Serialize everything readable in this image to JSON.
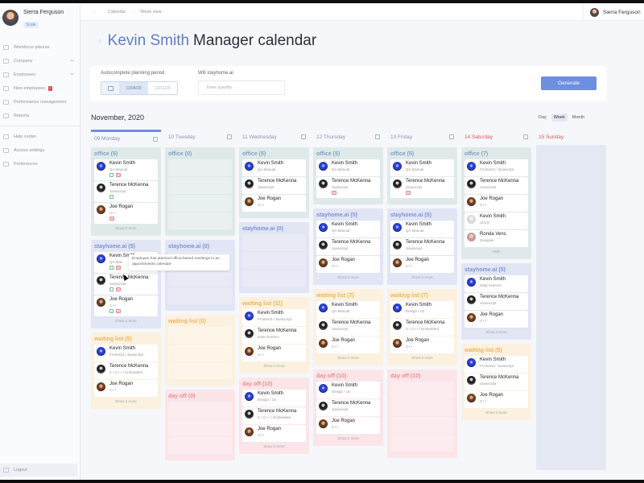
{
  "sidebar": {
    "user_name": "Sierra Ferguson",
    "user_badge": "Scale",
    "items": [
      {
        "label": "Workforce planner",
        "icon": "calendar-icon"
      },
      {
        "label": "Company",
        "icon": "building-icon"
      },
      {
        "label": "Employees",
        "icon": "users-icon"
      },
      {
        "label": "New employees",
        "icon": "user-plus-icon",
        "badge": "!"
      },
      {
        "label": "Performance management",
        "icon": "chart-icon"
      },
      {
        "label": "Reports",
        "icon": "report-icon"
      }
    ],
    "items2": [
      {
        "label": "Help center",
        "icon": "help-icon"
      },
      {
        "label": "Access settings",
        "icon": "lock-icon"
      },
      {
        "label": "Preferences",
        "icon": "gear-icon"
      }
    ],
    "logout": "Logout"
  },
  "topbar": {
    "breadcrumb": [
      "Calendar",
      "Week view"
    ],
    "user_name": "Sierra Ferguson"
  },
  "header": {
    "name": "Kevin Smith",
    "subtitle": "Manager calendar"
  },
  "planning": {
    "period_label": "Autocomplete planning period",
    "date_from": "11/04/20",
    "date_to": "12/11/20",
    "quantity_label": "Will stayhome.ai",
    "quantity_placeholder": "Enter quantity",
    "generate": "Generate"
  },
  "month": "November, 2020",
  "views": [
    "Day",
    "Week",
    "Month"
  ],
  "active_view": "Week",
  "tooltip": "Employee has planned office-based meetings in an appointments calendar",
  "show_more": "Show 2 more",
  "days": [
    {
      "label": "09 Monday",
      "weekend": false,
      "active": true,
      "sections": [
        {
          "type": "office",
          "title": "office (5)",
          "people": [
            {
              "name": "Kevin Smith",
              "role": "QA Manual",
              "av": "kevin",
              "icons": [
                "g",
                "r"
              ]
            },
            {
              "name": "Terence McKenna",
              "role": "Javascript",
              "av": "ter",
              "icons": [
                "g"
              ]
            },
            {
              "name": "Joe Rogan",
              "role": "C++",
              "av": "joe",
              "icons": [
                "r"
              ]
            }
          ],
          "more": true
        },
        {
          "type": "stay",
          "title": "stayhome.ai (5)",
          "people": [
            {
              "name": "Kevin Smith",
              "role": "QA Man",
              "av": "kevin",
              "icons": [
                "g",
                "r"
              ]
            },
            {
              "name": "Terence McKenna",
              "role": "Javascript",
              "av": "ter",
              "icons": [
                "g",
                "r"
              ]
            },
            {
              "name": "Joe Rogan",
              "role": "C++",
              "av": "joe",
              "icons": [
                "g",
                "r"
              ]
            }
          ],
          "more": true
        },
        {
          "type": "wait",
          "title": "waiting list (5)",
          "people": [
            {
              "name": "Kevin Smith",
              "role": "Frontend / Javascript",
              "av": "kevin"
            },
            {
              "name": "Terence McKenna",
              "role": "C / C++ / Embedded",
              "av": "ter"
            },
            {
              "name": "Joe Rogan",
              "role": "C++",
              "av": "joe"
            }
          ],
          "more": true
        }
      ]
    },
    {
      "label": "10 Tuesday",
      "weekend": false,
      "sections": [
        {
          "type": "office",
          "title": "office (0)",
          "slots": 4
        },
        {
          "type": "stay",
          "title": "stayhome.ai (0)",
          "slots": 3
        },
        {
          "type": "wait",
          "title": "waiting list (0)",
          "slots": 3
        },
        {
          "type": "off",
          "title": "day off (0)",
          "slots": 3
        }
      ]
    },
    {
      "label": "11 Wednesday",
      "weekend": false,
      "sections": [
        {
          "type": "office",
          "title": "office (5)",
          "people": [
            {
              "name": "Kevin Smith",
              "role": "QA Manual",
              "av": "kevin"
            },
            {
              "name": "Terence McKenna",
              "role": "Javascript",
              "av": "ter"
            },
            {
              "name": "Joe Rogan",
              "role": "C++",
              "av": "joe"
            }
          ]
        },
        {
          "type": "stay",
          "title": "stayhome.ai (0)",
          "slots": 3
        },
        {
          "type": "wait",
          "title": "waiting list (11)",
          "people": [
            {
              "name": "Kevin Smith",
              "role": "Frontend / Javascript",
              "av": "kevin"
            },
            {
              "name": "Terence McKenna",
              "role": "Data Science",
              "av": "ter"
            },
            {
              "name": "Joe Rogan",
              "role": "C++",
              "av": "joe"
            }
          ],
          "more": true
        },
        {
          "type": "off",
          "title": "day off (10)",
          "people": [
            {
              "name": "Kevin Smith",
              "role": "Design / Ux",
              "av": "kevin"
            },
            {
              "name": "Terence McKenna",
              "role": "C / C++ / Embedded",
              "av": "ter"
            },
            {
              "name": "Joe Rogan",
              "role": "C++",
              "av": "joe"
            }
          ],
          "more": true
        }
      ]
    },
    {
      "label": "12 Thursday",
      "weekend": false,
      "sections": [
        {
          "type": "office",
          "title": "office (5)",
          "people": [
            {
              "name": "Kevin Smith",
              "role": "QA Manual",
              "av": "kevin"
            },
            {
              "name": "Terence McKenna",
              "role": "Javascript",
              "av": "ter",
              "icons": [
                "r"
              ]
            }
          ]
        },
        {
          "type": "stay",
          "title": "stayhome.ai (5)",
          "people": [
            {
              "name": "Kevin Smith",
              "role": "QA Manual",
              "av": "kevin"
            },
            {
              "name": "Terence McKenna",
              "role": "Javascript",
              "av": "ter"
            },
            {
              "name": "Joe Rogan",
              "role": "C++",
              "av": "joe"
            }
          ],
          "more": true
        },
        {
          "type": "wait",
          "title": "waiting list (7)",
          "people": [
            {
              "name": "Kevin Smith",
              "role": "QA Manual",
              "av": "kevin"
            },
            {
              "name": "Terence McKenna",
              "role": "Javascript",
              "av": "ter"
            },
            {
              "name": "Joe Rogan",
              "role": "C++",
              "av": "joe"
            }
          ],
          "more": true
        },
        {
          "type": "off",
          "title": "day off (10)",
          "people": [
            {
              "name": "Kevin Smith",
              "role": "Design / Ux",
              "av": "kevin"
            },
            {
              "name": "Terence McKenna",
              "role": "Javascript",
              "av": "ter"
            },
            {
              "name": "Joe Rogan",
              "role": "C++",
              "av": "joe"
            }
          ],
          "more": true
        }
      ]
    },
    {
      "label": "13 Friday",
      "weekend": false,
      "sections": [
        {
          "type": "office",
          "title": "office (5)",
          "people": [
            {
              "name": "Kevin Smith",
              "role": "QA Manual",
              "av": "kevin"
            },
            {
              "name": "Terence McKenna",
              "role": "Javascript",
              "av": "ter",
              "icons": [
                "r"
              ]
            }
          ]
        },
        {
          "type": "stay",
          "title": "stayhome.ai (5)",
          "people": [
            {
              "name": "Kevin Smith",
              "role": "QA Manual",
              "av": "kevin"
            },
            {
              "name": "Terence McKenna",
              "role": "Javascript",
              "av": "ter"
            },
            {
              "name": "Joe Rogan",
              "role": "C++",
              "av": "joe"
            }
          ],
          "more": true
        },
        {
          "type": "wait",
          "title": "waiting list (7)",
          "people": [
            {
              "name": "Kevin Smith",
              "role": "Design / Ux",
              "av": "kevin"
            },
            {
              "name": "Terence McKenna",
              "role": "C / C++ / Embedded",
              "av": "ter"
            },
            {
              "name": "Joe Rogan",
              "role": "C++",
              "av": "joe"
            }
          ],
          "more": true
        },
        {
          "type": "off",
          "title": "day off (10)",
          "slots": 4
        }
      ]
    },
    {
      "label": "14 Saturday",
      "weekend": true,
      "sections": [
        {
          "type": "office",
          "title": "office (7)",
          "people": [
            {
              "name": "Kevin Smith",
              "role": "Frontend / Javascript",
              "av": "kevin"
            },
            {
              "name": "Terence McKenna",
              "role": "Javascript",
              "av": "ter"
            },
            {
              "name": "Joe Rogan",
              "role": "C++",
              "av": "joe"
            },
            {
              "name": "Kevin Smith",
              "role": "UI/UX",
              "av": "smith"
            },
            {
              "name": "Ronda Vens",
              "role": "Designer",
              "av": "ronda"
            }
          ],
          "more": true,
          "more_label": "Hide"
        },
        {
          "type": "stay",
          "title": "stayhome.ai (5)",
          "people": [
            {
              "name": "Kevin Smith",
              "role": "Data Science",
              "av": "kevin"
            },
            {
              "name": "Terence McKenna",
              "role": "Javascript",
              "av": "ter"
            },
            {
              "name": "Joe Rogan",
              "role": "C++",
              "av": "joe"
            }
          ],
          "more": true
        },
        {
          "type": "wait",
          "title": "waiting list (5)",
          "people": [
            {
              "name": "Kevin Smith",
              "role": "Frontend / Javascript",
              "av": "kevin"
            },
            {
              "name": "Terence McKenna",
              "role": "Javascript",
              "av": "ter"
            },
            {
              "name": "Joe Rogan",
              "role": "C++",
              "av": "joe"
            }
          ],
          "more": true
        }
      ]
    },
    {
      "label": "15 Sunday",
      "weekend": true,
      "sections": []
    }
  ]
}
